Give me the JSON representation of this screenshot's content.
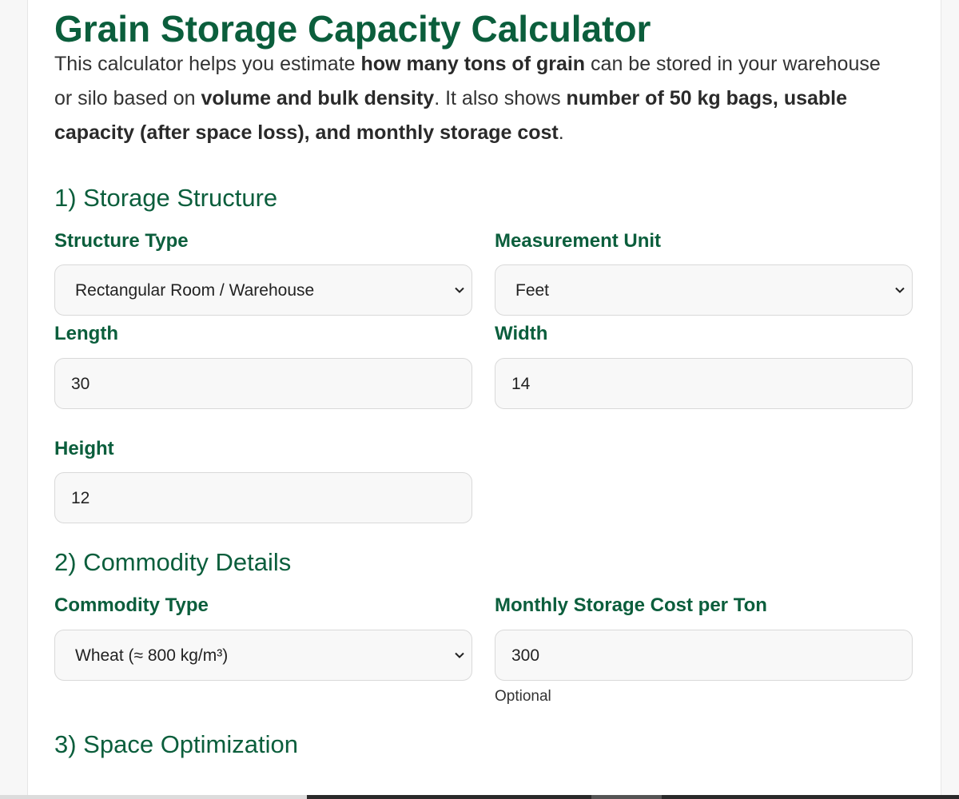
{
  "title": "Grain Storage Capacity Calculator",
  "intro": {
    "t1": "This calculator helps you estimate ",
    "b1": "how many tons of grain",
    "t2": " can be stored in your warehouse or silo based on ",
    "b2": "volume and bulk density",
    "t3": ". It also shows ",
    "b3": "number of 50 kg bags, usable capacity (after space loss), and monthly storage cost",
    "t4": "."
  },
  "sections": {
    "structure": {
      "heading": "1) Storage Structure",
      "structure_type": {
        "label": "Structure Type",
        "value": "Rectangular Room / Warehouse"
      },
      "measurement_unit": {
        "label": "Measurement Unit",
        "value": "Feet"
      },
      "length": {
        "label": "Length",
        "value": "30"
      },
      "width": {
        "label": "Width",
        "value": "14"
      },
      "height": {
        "label": "Height",
        "value": "12"
      }
    },
    "commodity": {
      "heading": "2) Commodity Details",
      "commodity_type": {
        "label": "Commodity Type",
        "value": "Wheat (≈ 800 kg/m³)"
      },
      "storage_cost": {
        "label": "Monthly Storage Cost per Ton",
        "value": "300",
        "hint": "Optional"
      }
    },
    "space": {
      "heading": "3) Space Optimization"
    }
  },
  "icons": {
    "select_chevron": "chevron-down-icon"
  },
  "colors": {
    "accent": "#0b5e3c",
    "field_bg": "#f8f8f8",
    "field_border": "#d9d9d9"
  }
}
